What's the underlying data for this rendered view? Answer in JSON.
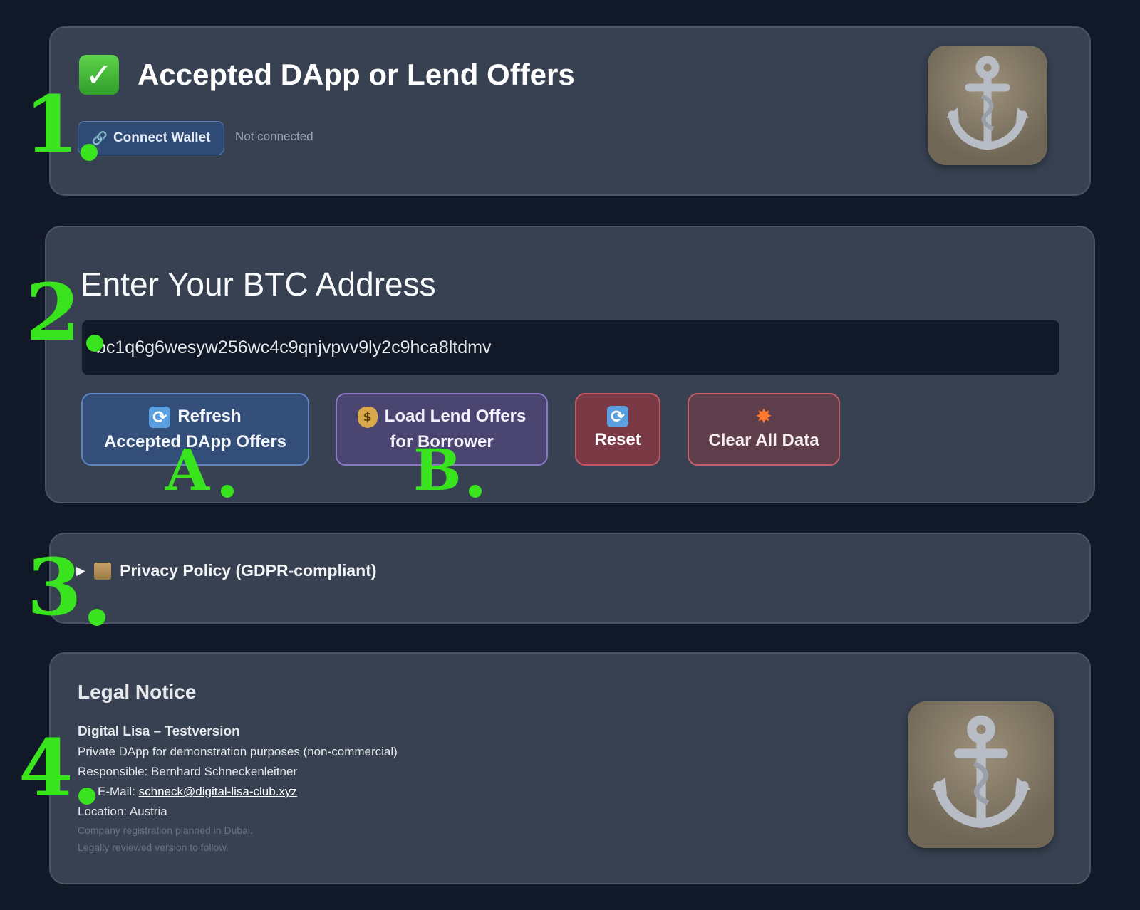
{
  "header": {
    "check_icon": "✓",
    "title": "Accepted DApp or Lend Offers",
    "connect_button_icon": "🔗",
    "connect_button_label": "Connect Wallet",
    "connection_status": "Not connected",
    "logo_icon": "anchor-icon"
  },
  "btc_section": {
    "heading": "Enter Your BTC Address",
    "address_value": "bc1q6g6wesyw256wc4c9qnjvpvv9ly2c9hca8ltdmv",
    "buttons": {
      "refresh": {
        "line1": "Refresh",
        "line2": "Accepted DApp Offers"
      },
      "load": {
        "line1": "Load Lend Offers",
        "line2": "for Borrower"
      },
      "reset": {
        "label": "Reset"
      },
      "clear": {
        "label": "Clear All Data"
      }
    }
  },
  "privacy": {
    "label": "Privacy Policy (GDPR-compliant)"
  },
  "legal": {
    "heading": "Legal Notice",
    "org": "Digital Lisa – Testversion",
    "purpose": "Private DApp for demonstration purposes (non-commercial)",
    "responsible": "Responsible: Bernhard Schneckenleitner",
    "email_label": "E-Mail:",
    "email": "schneck@digital-lisa-club.xyz",
    "location": "Location: Austria",
    "note1": "Company registration planned in Dubai.",
    "note2": "Legally reviewed version to follow."
  },
  "markers": {
    "m1": "1",
    "m2": "2",
    "m3": "3",
    "m4": "4",
    "mA": "A",
    "mB": "B"
  },
  "colors": {
    "page_bg": "#111827",
    "card_bg": "#374151",
    "marker_green": "#39e31d"
  }
}
